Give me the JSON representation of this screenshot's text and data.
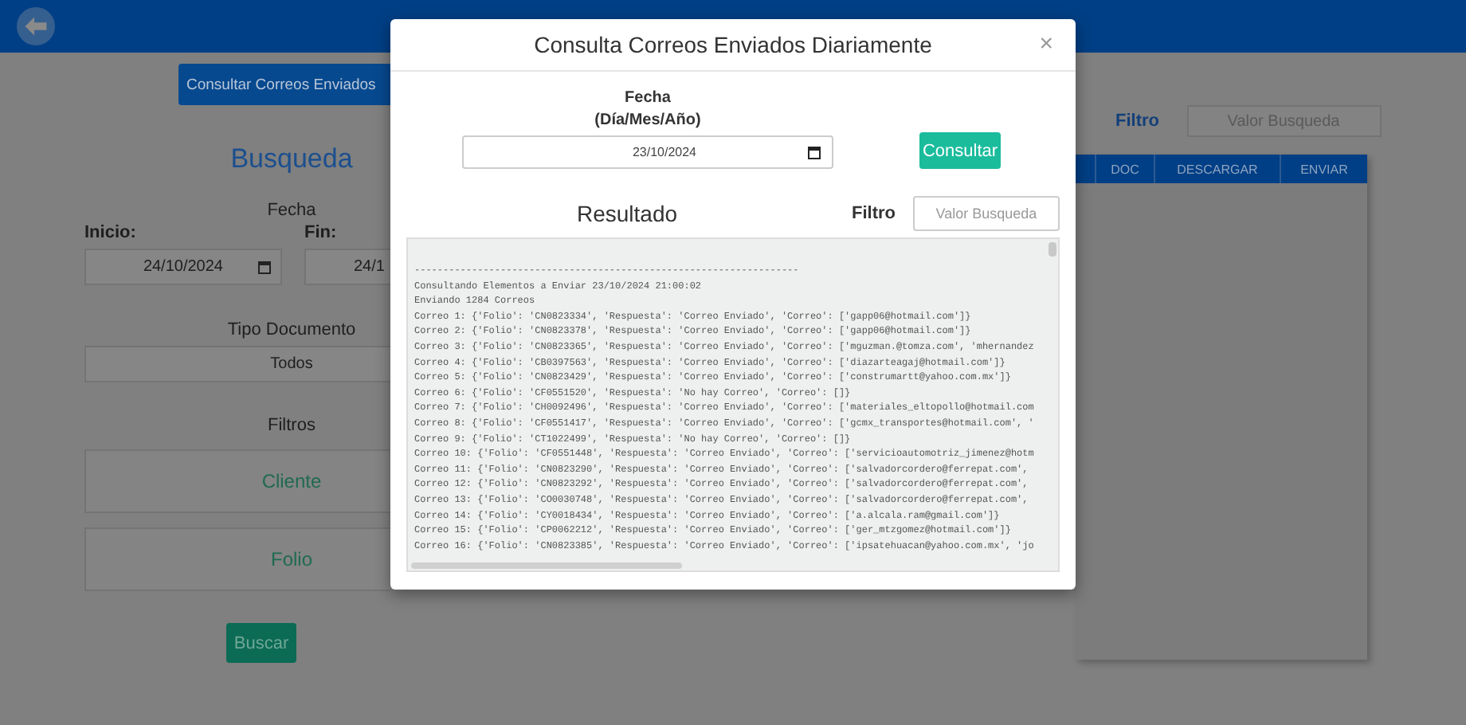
{
  "left_panel": {
    "consult_button": "Consultar Correos Enviados",
    "title": "Busqueda",
    "date_label": "Fecha",
    "start_label": "Inicio:",
    "start_value": "24/10/2024",
    "end_label": "Fin:",
    "end_value": "24/1",
    "doc_type_label": "Tipo Documento",
    "doc_type_value": "Todos",
    "filters_label": "Filtros",
    "filters": [
      {
        "label": "Cliente"
      },
      {
        "label": "Folio"
      }
    ],
    "search_button": "Buscar"
  },
  "right_panel": {
    "filter_label": "Filtro",
    "filter_placeholder": "Valor Busqueda",
    "columns": [
      "",
      "DOC",
      "DESCARGAR",
      "ENVIAR"
    ]
  },
  "modal": {
    "title": "Consulta Correos Enviados Diariamente",
    "close": "×",
    "date_label": "Fecha",
    "date_hint": "(Día/Mes/Año)",
    "date_value": "23/10/2024",
    "consult_button": "Consultar",
    "result_label": "Resultado",
    "filter_label": "Filtro",
    "filter_placeholder": "Valor Busqueda",
    "log": [
      "-------------------------------------------------------------------",
      "Consultando Elementos a Enviar 23/10/2024 21:00:02",
      "Enviando 1284 Correos",
      "Correo 1: {'Folio': 'CN0823334', 'Respuesta': 'Correo Enviado', 'Correo': ['gapp06@hotmail.com']}",
      "Correo 2: {'Folio': 'CN0823378', 'Respuesta': 'Correo Enviado', 'Correo': ['gapp06@hotmail.com']}",
      "Correo 3: {'Folio': 'CN0823365', 'Respuesta': 'Correo Enviado', 'Correo': ['mguzman.@tomza.com', 'mhernandez",
      "Correo 4: {'Folio': 'CB0397563', 'Respuesta': 'Correo Enviado', 'Correo': ['diazarteagaj@hotmail.com']}",
      "Correo 5: {'Folio': 'CN0823429', 'Respuesta': 'Correo Enviado', 'Correo': ['construmartt@yahoo.com.mx']}",
      "Correo 6: {'Folio': 'CF0551520', 'Respuesta': 'No hay Correo', 'Correo': []}",
      "Correo 7: {'Folio': 'CH0092496', 'Respuesta': 'Correo Enviado', 'Correo': ['materiales_eltopollo@hotmail.com",
      "Correo 8: {'Folio': 'CF0551417', 'Respuesta': 'Correo Enviado', 'Correo': ['gcmx_transportes@hotmail.com', '",
      "Correo 9: {'Folio': 'CT1022499', 'Respuesta': 'No hay Correo', 'Correo': []}",
      "Correo 10: {'Folio': 'CF0551448', 'Respuesta': 'Correo Enviado', 'Correo': ['servicioautomotriz_jimenez@hotm",
      "Correo 11: {'Folio': 'CN0823290', 'Respuesta': 'Correo Enviado', 'Correo': ['salvadorcordero@ferrepat.com',",
      "Correo 12: {'Folio': 'CN0823292', 'Respuesta': 'Correo Enviado', 'Correo': ['salvadorcordero@ferrepat.com',",
      "Correo 13: {'Folio': 'CO0030748', 'Respuesta': 'Correo Enviado', 'Correo': ['salvadorcordero@ferrepat.com',",
      "Correo 14: {'Folio': 'CY0018434', 'Respuesta': 'Correo Enviado', 'Correo': ['a.alcala.ram@gmail.com']}",
      "Correo 15: {'Folio': 'CP0062212', 'Respuesta': 'Correo Enviado', 'Correo': ['ger_mtzgomez@hotmail.com']}",
      "Correo 16: {'Folio': 'CN0823385', 'Respuesta': 'Correo Enviado', 'Correo': ['ipsatehuacan@yahoo.com.mx', 'jo"
    ]
  }
}
